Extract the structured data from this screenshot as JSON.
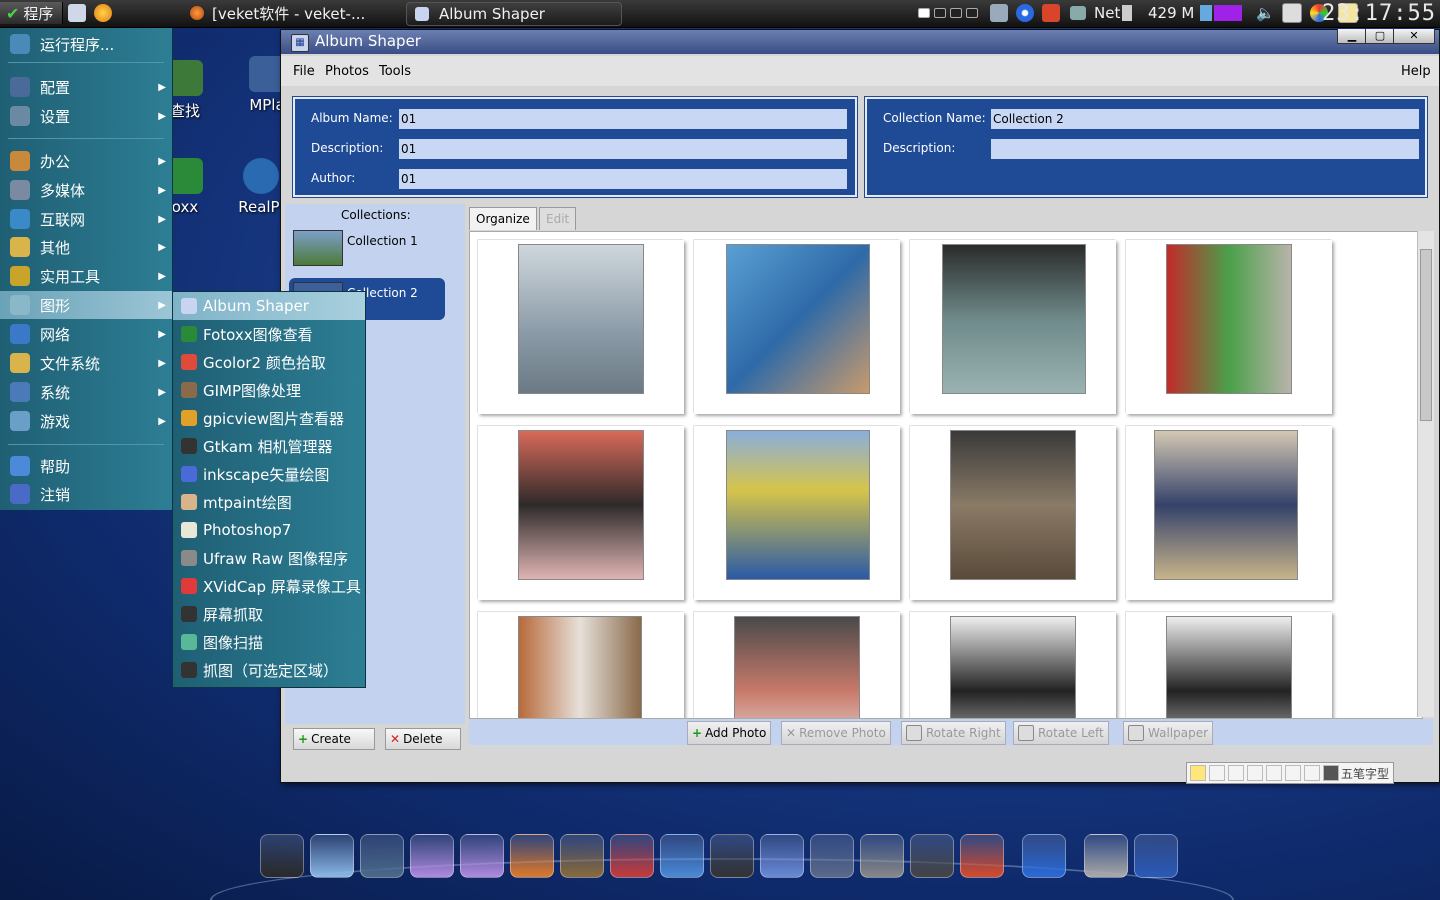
{
  "top_panel": {
    "start_label": "程序",
    "task1": "[veket软件 - veket-...",
    "task2": "Album Shaper",
    "net_label": "Net",
    "mem_label": "429 M",
    "clock": "23:17:55"
  },
  "desktop": {
    "icons": [
      {
        "label": "查找"
      },
      {
        "label": "MPla"
      },
      {
        "label": "oxx"
      },
      {
        "label": "RealPl"
      }
    ]
  },
  "window": {
    "title": "Album Shaper",
    "menus": {
      "file": "File",
      "photos": "Photos",
      "tools": "Tools",
      "help": "Help"
    },
    "album": {
      "name_label": "Album Name:",
      "name_value": "01",
      "desc_label": "Description:",
      "desc_value": "01",
      "author_label": "Author:",
      "author_value": "01"
    },
    "collection": {
      "name_label": "Collection Name:",
      "name_value": "Collection 2",
      "desc_label": "Description:",
      "desc_value": ""
    },
    "collections": {
      "title": "Collections:",
      "items": [
        "Collection 1",
        "Collection 2"
      ]
    },
    "buttons": {
      "create": "Create",
      "delete": "Delete"
    },
    "tabs": {
      "organize": "Organize",
      "edit": "Edit"
    },
    "photo_toolbar": {
      "add": "Add Photo",
      "remove": "Remove Photo",
      "rotate_right": "Rotate Right",
      "rotate_left": "Rotate Left",
      "wallpaper": "Wallpaper"
    }
  },
  "start_menu": {
    "items": [
      {
        "label": "运行程序...",
        "submenu": false
      },
      {
        "label": "配置",
        "submenu": true
      },
      {
        "label": "设置",
        "submenu": true
      },
      {
        "label": "办公",
        "submenu": true
      },
      {
        "label": "多媒体",
        "submenu": true
      },
      {
        "label": "互联网",
        "submenu": true
      },
      {
        "label": "其他",
        "submenu": true
      },
      {
        "label": "实用工具",
        "submenu": true
      },
      {
        "label": "图形",
        "submenu": true
      },
      {
        "label": "网络",
        "submenu": true
      },
      {
        "label": "文件系统",
        "submenu": true
      },
      {
        "label": "系统",
        "submenu": true
      },
      {
        "label": "游戏",
        "submenu": true
      },
      {
        "label": "帮助",
        "submenu": false
      },
      {
        "label": "注销",
        "submenu": false
      }
    ],
    "graphics_submenu": [
      "Album Shaper",
      "Fotoxx图像查看",
      "Gcolor2 颜色拾取",
      "GIMP图像处理",
      "gpicview图片查看器",
      "Gtkam 相机管理器",
      "inkscape矢量绘图",
      "mtpaint绘图",
      "Photoshop7",
      "Ufraw Raw 图像程序",
      "XVidCap 屏幕录像工具",
      "屏幕抓取",
      "图像扫描",
      "抓图（可选定区域）"
    ]
  },
  "ime": {
    "label": "五笔字型"
  },
  "colors": {
    "panel_blue": "#1f4a96",
    "sidebar_blue": "#c3d3ef",
    "menu_teal": "#2d7e94"
  }
}
